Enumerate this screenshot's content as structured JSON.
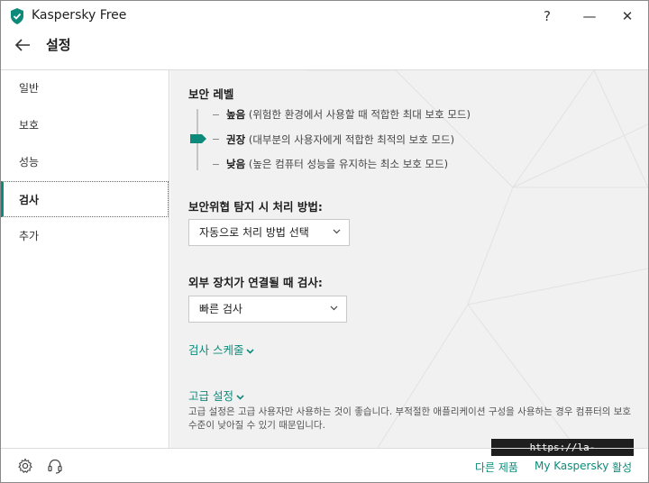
{
  "window": {
    "title": "Kaspersky Free",
    "help_label": "?",
    "minimize_label": "—",
    "close_label": "✕"
  },
  "header": {
    "title": "설정"
  },
  "sidebar": {
    "items": [
      {
        "label": "일반"
      },
      {
        "label": "보호"
      },
      {
        "label": "성능"
      },
      {
        "label": "검사"
      },
      {
        "label": "추가"
      }
    ],
    "active_index": 3
  },
  "main": {
    "security_level": {
      "heading": "보안 레벨",
      "levels": [
        {
          "name": "높음",
          "desc": " (위험한 환경에서 사용할 때 적합한 최대 보호 모드)"
        },
        {
          "name": "권장",
          "desc": " (대부분의 사용자에게 적합한 최적의 보호 모드)"
        },
        {
          "name": "낮음",
          "desc": " (높은 컴퓨터 성능을 유지하는 최소 보호 모드)"
        }
      ],
      "selected_index": 1
    },
    "threat_action": {
      "heading": "보안위협 탐지 시 처리 방법:",
      "value": "자동으로 처리 방법 선택"
    },
    "external_device": {
      "heading": "외부 장치가 연결될 때 검사:",
      "value": "빠른 검사"
    },
    "scan_schedule_link": "검사 스케줄",
    "advanced": {
      "link": "고급 설정",
      "description": "고급 설정은 고급 사용자만 사용하는 것이 좋습니다. 부적절한 애플리케이션 구성을 사용하는 경우 컴퓨터의 보호 수준이 낮아질 수 있기 때문입니다."
    }
  },
  "footer": {
    "other_products": "다른 제품",
    "my_kaspersky": "My Kaspersky",
    "activate": "활성"
  },
  "watermark": "https://la-nube.tistory.com",
  "colors": {
    "accent": "#0e8a7a",
    "main_bg": "#f1f1f1"
  },
  "icons": {
    "app": "kaspersky-shield-icon",
    "back": "arrow-left-icon",
    "settings": "gear-icon",
    "support": "headset-icon"
  }
}
